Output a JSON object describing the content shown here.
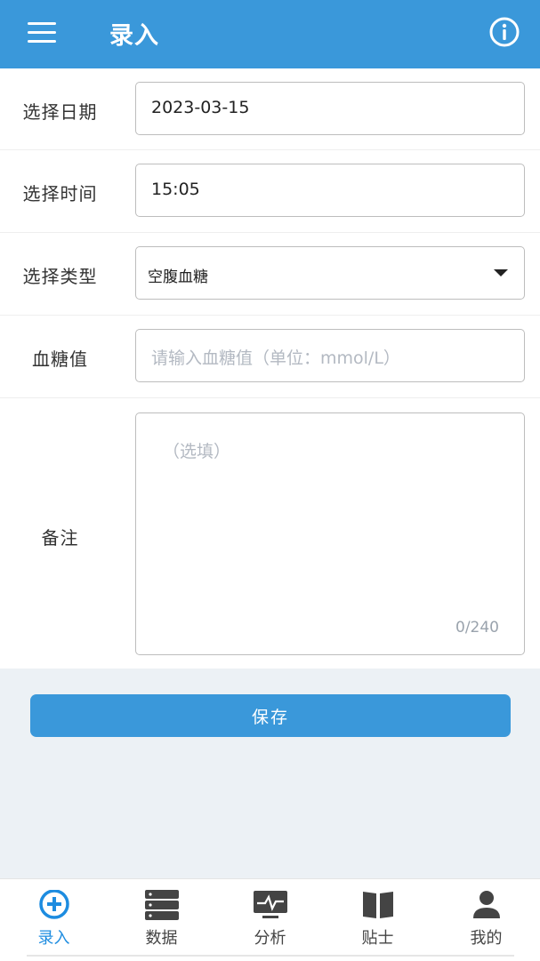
{
  "header": {
    "title": "录入",
    "menu_icon": "menu-icon",
    "info_icon": "info-icon"
  },
  "form": {
    "date": {
      "label": "选择日期",
      "value": "2023-03-15"
    },
    "time": {
      "label": "选择时间",
      "value": "15:05"
    },
    "type": {
      "label": "选择类型",
      "value": "空腹血糖",
      "dropdown_icon": "chevron-down-icon"
    },
    "glucose": {
      "label": "血糖值",
      "placeholder": "请输入血糖值（单位：mmol/L）"
    },
    "note": {
      "label": "备注",
      "placeholder": "（选填）",
      "counter": "0/240"
    }
  },
  "save_button": {
    "label": "保存"
  },
  "bottom_nav": {
    "items": [
      {
        "label": "录入",
        "icon": "plus-circle-icon",
        "active": true
      },
      {
        "label": "数据",
        "icon": "database-icon",
        "active": false
      },
      {
        "label": "分析",
        "icon": "monitor-pulse-icon",
        "active": false
      },
      {
        "label": "贴士",
        "icon": "book-icon",
        "active": false
      },
      {
        "label": "我的",
        "icon": "person-icon",
        "active": false
      }
    ]
  },
  "colors": {
    "primary": "#3a98da",
    "active_nav": "#1d8ce0",
    "inactive_icon": "#444444",
    "background": "#ecf1f5"
  }
}
